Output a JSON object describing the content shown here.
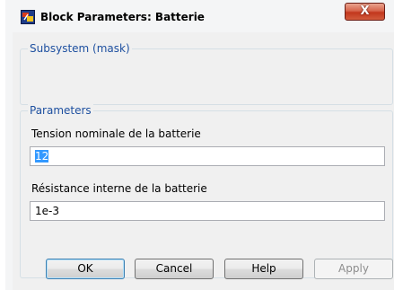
{
  "window": {
    "title": "Block Parameters: Batterie",
    "close_label": "X"
  },
  "subsystem_group": {
    "title": "Subsystem (mask)"
  },
  "parameters_group": {
    "title": "Parameters",
    "fields": [
      {
        "label": "Tension nominale de la batterie",
        "value": "12"
      },
      {
        "label": "Résistance interne de la batterie",
        "value": "1e-3"
      }
    ]
  },
  "buttons": {
    "ok": "OK",
    "cancel": "Cancel",
    "help": "Help",
    "apply": "Apply"
  }
}
